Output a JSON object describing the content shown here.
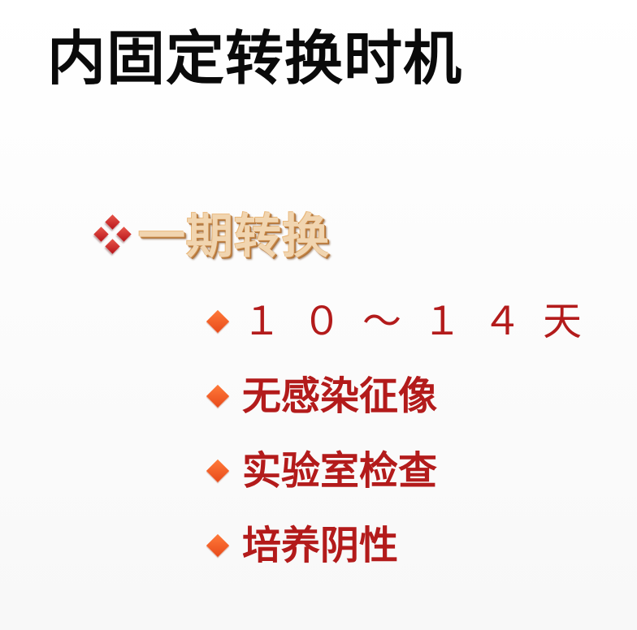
{
  "slide": {
    "title": "内固定转换时机",
    "heading": "一期转换",
    "items": [
      "１０～１４天",
      "无感染征像",
      "实验室检查",
      "培养阴性"
    ]
  },
  "colors": {
    "title": "#0a0a0a",
    "heading": "#f1d5b0",
    "item_text": "#b31b1b",
    "bullet_cluster": "#c8141a",
    "bullet_diamond": "#f0552a"
  },
  "icons": {
    "level1_bullet": "diamond-cluster-icon",
    "level2_bullet": "diamond-bullet-icon"
  }
}
